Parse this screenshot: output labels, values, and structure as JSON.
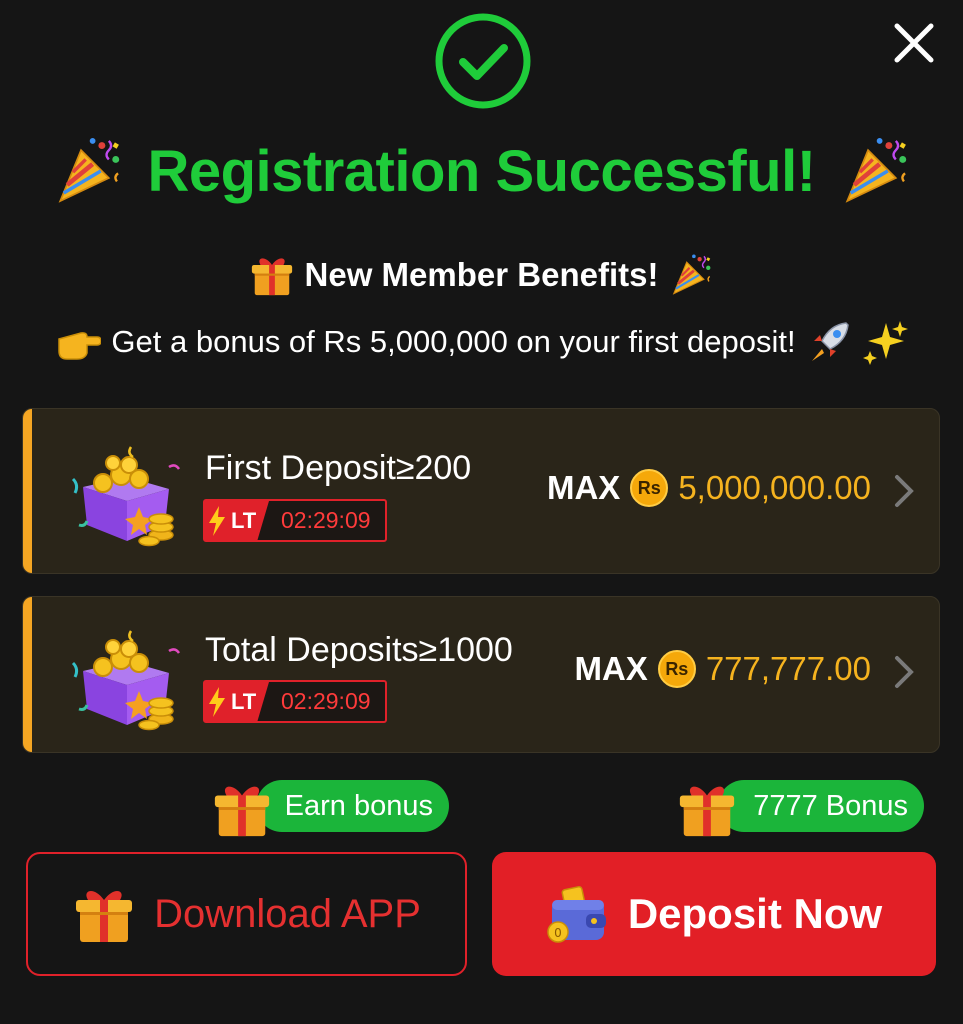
{
  "modal": {
    "title": "Registration Successful!",
    "subtitle": "New Member Benefits!",
    "bonus_line": "Get a bonus of Rs 5,000,000 on your first deposit!",
    "icons": {
      "check": "check-circle-icon",
      "close": "close-icon",
      "party": "party-popper-icon",
      "gift": "gift-icon",
      "pointer": "pointing-hand-icon",
      "rocket": "rocket-icon",
      "sparkles": "sparkles-icon",
      "wallet": "wallet-icon"
    }
  },
  "cards": [
    {
      "label": "First Deposit≥200",
      "badge": "LT",
      "timer": "02:29:09",
      "max_label": "MAX",
      "currency": "Rs",
      "amount": "5,000,000.00"
    },
    {
      "label": "Total Deposits≥1000",
      "badge": "LT",
      "timer": "02:29:09",
      "max_label": "MAX",
      "currency": "Rs",
      "amount": "777,777.00"
    }
  ],
  "pills": {
    "earn": "Earn bonus",
    "bonus": "7777 Bonus"
  },
  "buttons": {
    "download": "Download APP",
    "deposit": "Deposit Now"
  },
  "colors": {
    "success": "#1fcc3a",
    "accent": "#f5a623",
    "danger": "#e21f26",
    "card": "#2a2519"
  }
}
